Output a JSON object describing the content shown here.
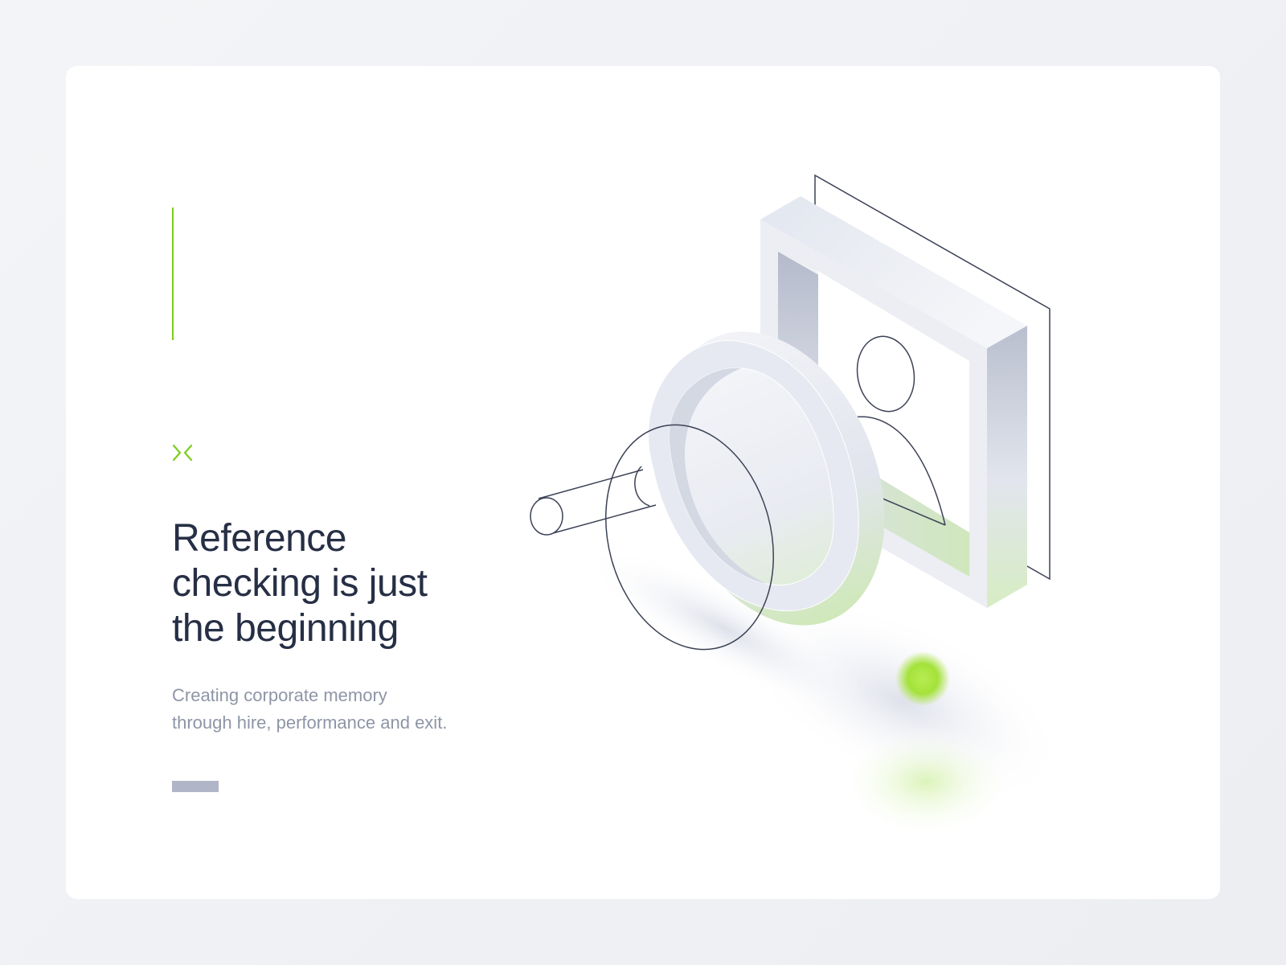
{
  "hero": {
    "headline_line1": "Reference",
    "headline_line2": "checking is just",
    "headline_line3": "the beginning",
    "subtitle_line1": "Creating corporate memory",
    "subtitle_line2": "through hire, performance and exit."
  },
  "icons": {
    "logo": "x-mark-logo-icon",
    "illustration": "magnifier-over-profile-frame-icon"
  },
  "colors": {
    "accent": "#7ccd1e",
    "headline": "#262f45",
    "subtitle": "#8e95a6",
    "bar": "#b0b6c7"
  }
}
